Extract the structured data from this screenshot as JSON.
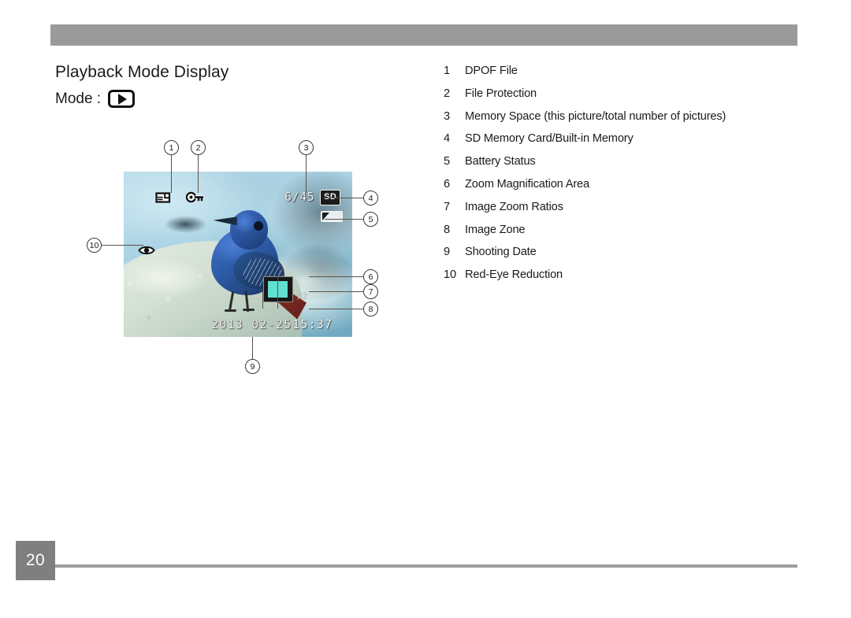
{
  "page": {
    "number": "20",
    "header_bar_color": "#9a9a9a",
    "page_number_box_color": "#7f7f7f"
  },
  "section": {
    "title": "Playback Mode Display",
    "mode_label": "Mode :",
    "mode_icon": "play-icon"
  },
  "legend": {
    "items": [
      {
        "num": "1",
        "label": "DPOF File"
      },
      {
        "num": "2",
        "label": "File Protection"
      },
      {
        "num": "3",
        "label": "Memory Space (this picture/total number of pictures)"
      },
      {
        "num": "4",
        "label": "SD Memory Card/Built-in Memory"
      },
      {
        "num": "5",
        "label": "Battery Status"
      },
      {
        "num": "6",
        "label": "Zoom Magnification Area"
      },
      {
        "num": "7",
        "label": "Image Zoom Ratios"
      },
      {
        "num": "8",
        "label": "Image Zone"
      },
      {
        "num": "9",
        "label": "Shooting Date"
      },
      {
        "num": "10",
        "label": "Red-Eye Reduction"
      }
    ]
  },
  "lcd": {
    "picture_count": "6/45",
    "card_badge": "SD",
    "zoom_ratio": "x2",
    "shooting_date": "2013 02-25",
    "shooting_time": "15:37",
    "zoom_area_color": "#5fe0d0",
    "icons": {
      "dpof": "dpof-file-icon",
      "protection": "key-icon",
      "red_eye": "eye-icon",
      "battery": "battery-icon"
    }
  },
  "callouts": [
    {
      "num": "1"
    },
    {
      "num": "2"
    },
    {
      "num": "3"
    },
    {
      "num": "4"
    },
    {
      "num": "5"
    },
    {
      "num": "6"
    },
    {
      "num": "7"
    },
    {
      "num": "8"
    },
    {
      "num": "9"
    },
    {
      "num": "10"
    }
  ]
}
